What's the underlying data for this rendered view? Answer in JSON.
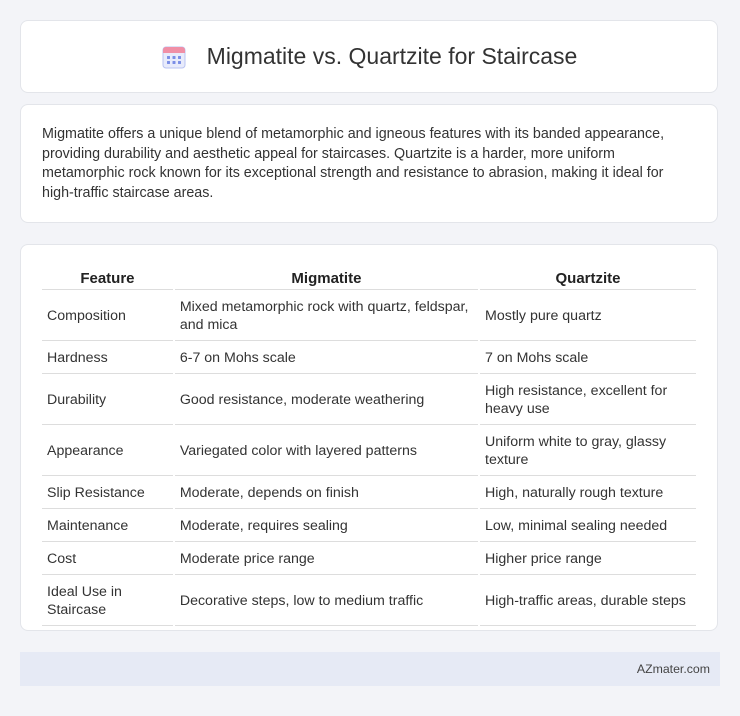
{
  "header": {
    "title": "Migmatite vs. Quartzite for Staircase",
    "icon": "calendar-icon"
  },
  "intro": {
    "text": "Migmatite offers a unique blend of metamorphic and igneous features with its banded appearance, providing durability and aesthetic appeal for staircases. Quartzite is a harder, more uniform metamorphic rock known for its exceptional strength and resistance to abrasion, making it ideal for high-traffic staircase areas."
  },
  "table": {
    "headers": [
      "Feature",
      "Migmatite",
      "Quartzite"
    ],
    "rows": [
      [
        "Composition",
        "Mixed metamorphic rock with quartz, feldspar, and mica",
        "Mostly pure quartz"
      ],
      [
        "Hardness",
        "6-7 on Mohs scale",
        "7 on Mohs scale"
      ],
      [
        "Durability",
        "Good resistance, moderate weathering",
        "High resistance, excellent for heavy use"
      ],
      [
        "Appearance",
        "Variegated color with layered patterns",
        "Uniform white to gray, glassy texture"
      ],
      [
        "Slip Resistance",
        "Moderate, depends on finish",
        "High, naturally rough texture"
      ],
      [
        "Maintenance",
        "Moderate, requires sealing",
        "Low, minimal sealing needed"
      ],
      [
        "Cost",
        "Moderate price range",
        "Higher price range"
      ],
      [
        "Ideal Use in Staircase",
        "Decorative steps, low to medium traffic",
        "High-traffic areas, durable steps"
      ]
    ]
  },
  "footer": {
    "brand": "AZmater.com"
  },
  "colors": {
    "background": "#f3f4f8",
    "card": "#ffffff",
    "footer": "#e6eaf5",
    "icon_accent": "#7b8ee6"
  }
}
